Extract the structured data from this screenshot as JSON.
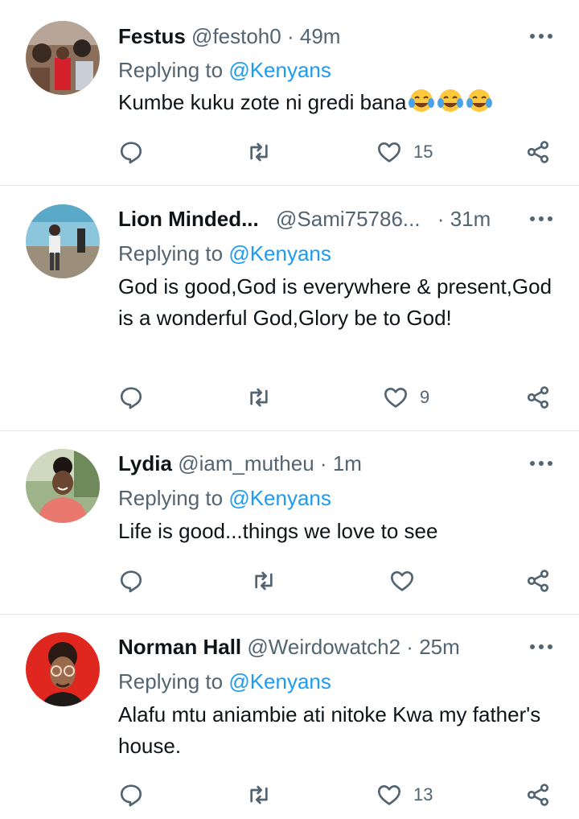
{
  "reply_prefix": "Replying to ",
  "colors": {
    "accent": "#1d9bf0",
    "secondary_text": "#536471",
    "divider": "#e1e6ea"
  },
  "tweets": [
    {
      "name": "Festus",
      "handle": "@festoh0",
      "separator": "·",
      "time": "49m",
      "reply_to": "@Kenyans",
      "text": "Kumbe kuku zote ni gredi bana",
      "emoji": [
        "face-with-tears-of-joy",
        "face-with-tears-of-joy",
        "face-with-tears-of-joy"
      ],
      "likes": "15"
    },
    {
      "name": "Lion Minded...",
      "handle": "@Sami75786...",
      "separator": "·",
      "time": "31m",
      "reply_to": "@Kenyans",
      "text": "God is good,God is everywhere & present,God is a wonderful God,Glory be to God!",
      "likes": "9"
    },
    {
      "name": "Lydia",
      "handle": "@iam_mutheu",
      "separator": "·",
      "time": "1m",
      "reply_to": "@Kenyans",
      "text": "Life is good...things we love to see",
      "likes": ""
    },
    {
      "name": "Norman Hall",
      "handle": "@Weirdowatch2",
      "separator": "·",
      "time": "25m",
      "reply_to": "@Kenyans",
      "text": "Alafu mtu aniambie ati nitoke Kwa my father's house.",
      "likes": "13"
    }
  ]
}
